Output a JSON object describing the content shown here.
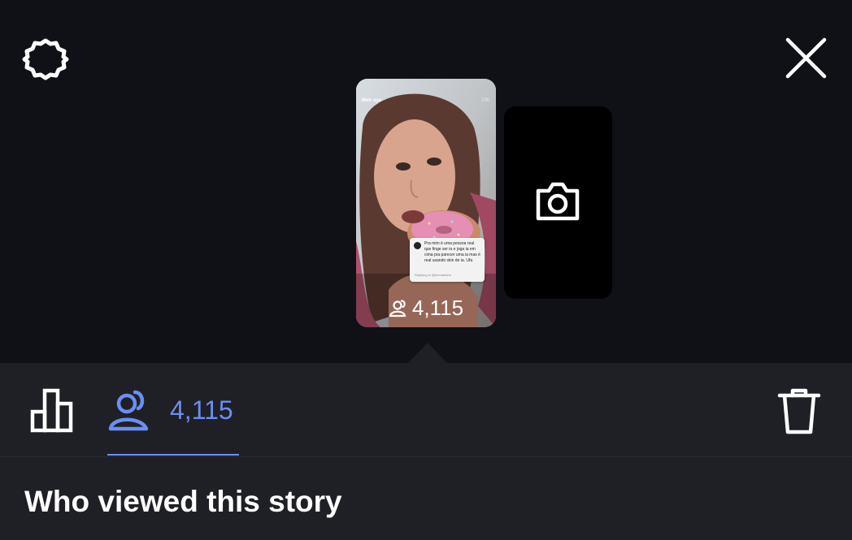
{
  "header": {
    "settings_icon": "gear-icon",
    "close_icon": "close-icon"
  },
  "story": {
    "username": "Meir aye",
    "time": "23h",
    "reply_card": {
      "text": "Pra mim é uma pessoa real que finge ser ia e joga ia em cima pra parecer uma ia mas é real usando skin de ia. Ufa",
      "meta": "Replying to @lennastoria"
    },
    "viewer_count": "4,115"
  },
  "camera_card": {
    "icon": "camera-icon"
  },
  "tabs": {
    "insights_icon": "bar-chart-icon",
    "viewers_icon": "viewers-icon",
    "viewers_count": "4,115",
    "delete_icon": "trash-icon"
  },
  "section": {
    "title": "Who viewed this story"
  },
  "colors": {
    "background": "#0f1117",
    "sheet": "#1f2025",
    "accent": "#6b8ef5"
  }
}
